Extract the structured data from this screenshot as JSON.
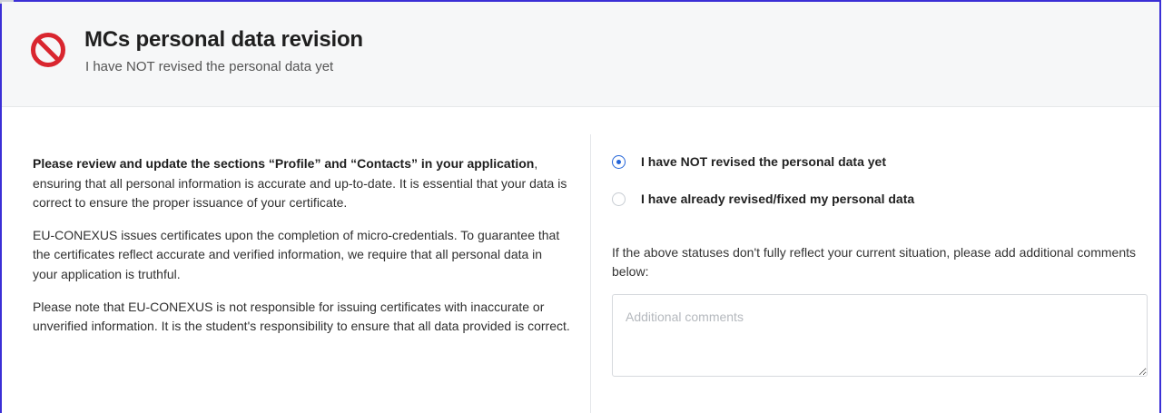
{
  "header": {
    "title": "MCs personal data revision",
    "subtitle": "I have NOT revised the personal data yet",
    "status_icon": "prohibited-icon",
    "status_color": "#d9262f"
  },
  "instructions": {
    "p1_bold": "Please review and update the sections “Profile” and “Contacts” in your application",
    "p1_rest": ", ensuring that all personal information is accurate and up-to-date. It is essential that your data is correct to ensure the proper issuance of your certificate.",
    "p2": "EU-CONEXUS issues certificates upon the completion of micro-credentials. To guarantee that the certificates reflect accurate and verified information, we require that all personal data in your application is truthful.",
    "p3": "Please note that EU-CONEXUS is not responsible for issuing certificates with inaccurate or unverified information. It is the student's responsibility to ensure that all data provided is correct."
  },
  "status_options": [
    {
      "label": "I have NOT revised the personal data yet",
      "checked": true
    },
    {
      "label": "I have already revised/fixed my personal data",
      "checked": false
    }
  ],
  "comments": {
    "helper": "If the above statuses don't fully reflect your current situation, please add additional comments below:",
    "placeholder": "Additional comments",
    "value": ""
  },
  "colors": {
    "accent": "#2465d8",
    "frame": "#3b2fd6"
  }
}
